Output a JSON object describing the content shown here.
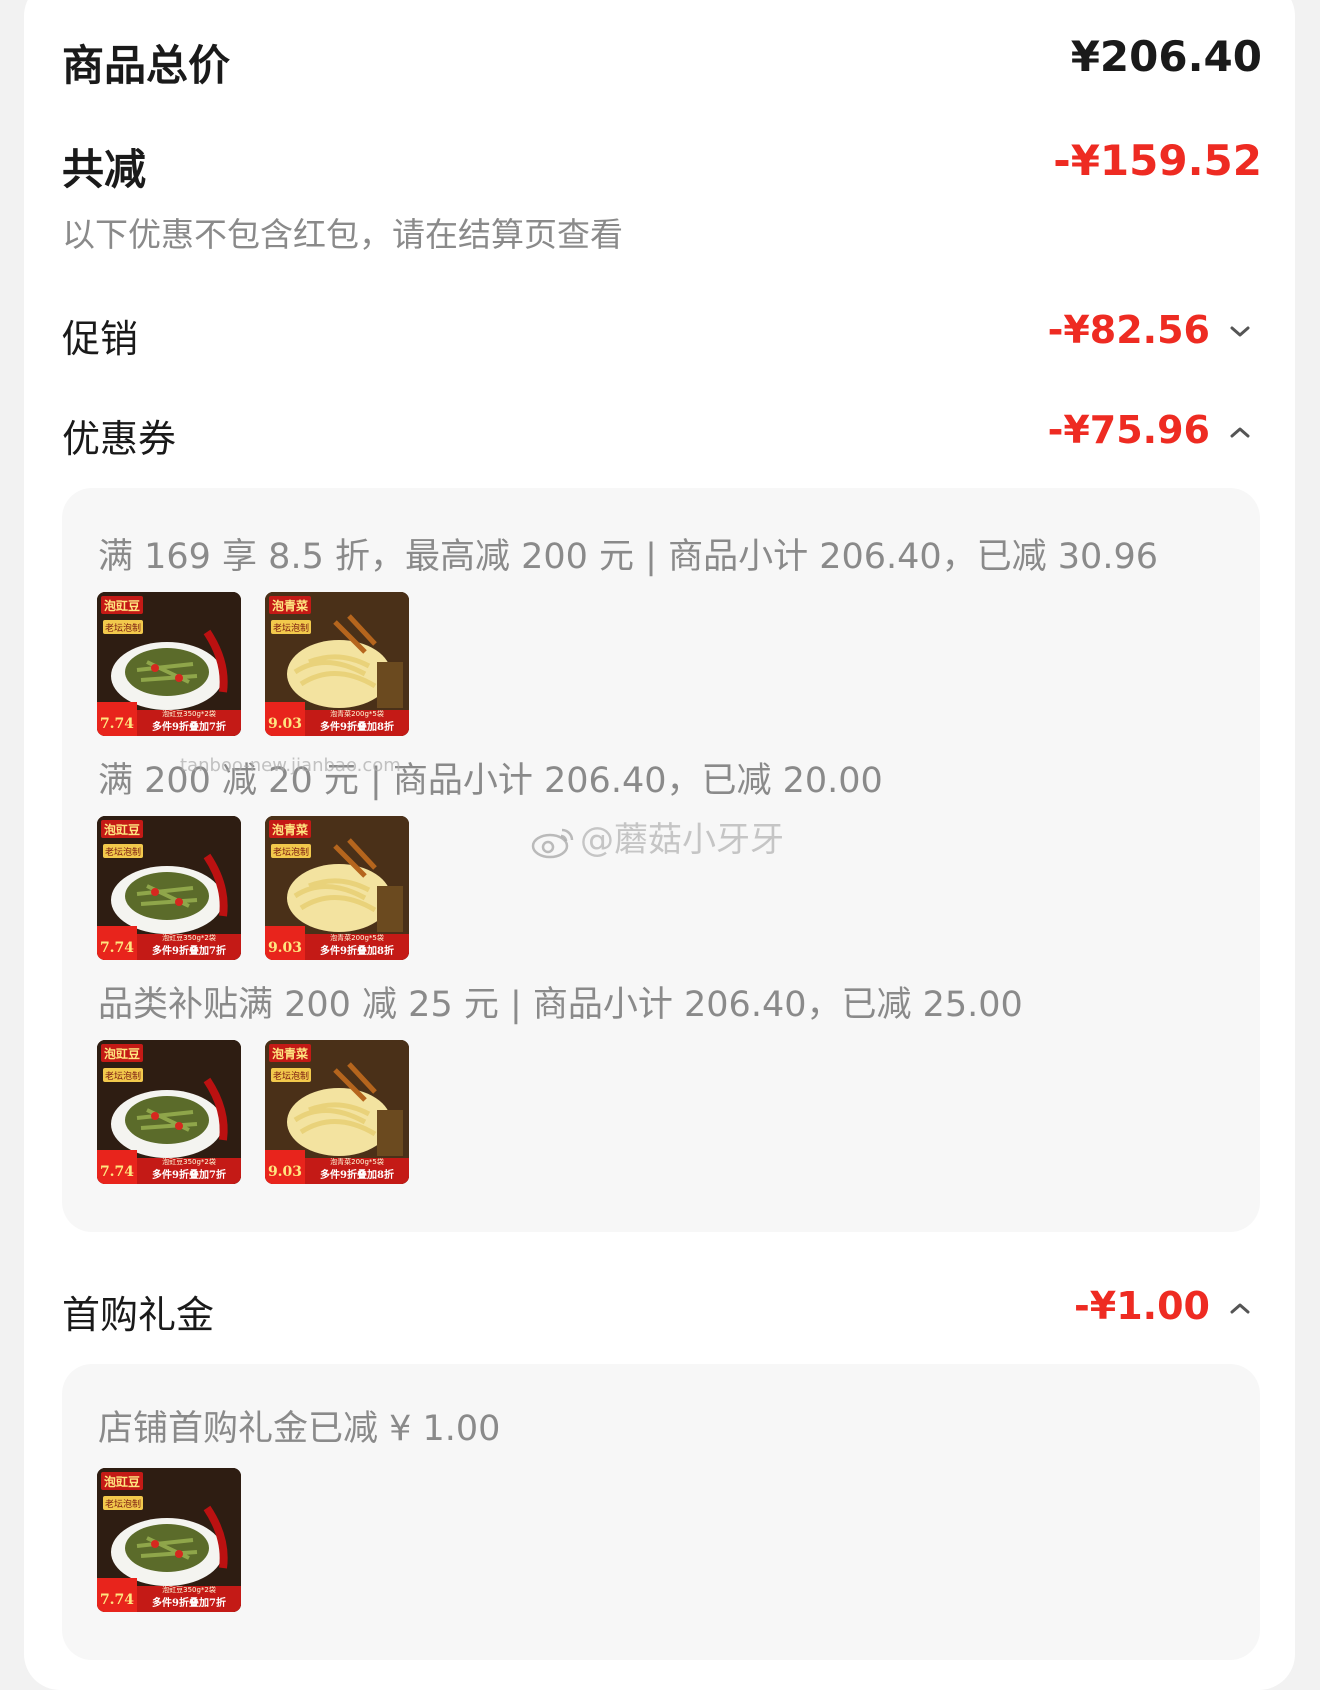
{
  "summary": {
    "total_label": "商品总价",
    "total_value": "¥206.40",
    "discount_label": "共减",
    "discount_value": "-¥159.52",
    "note": "以下优惠不包含红包，请在结算页查看"
  },
  "promotion": {
    "label": "促销",
    "value": "-¥82.56",
    "expanded": false
  },
  "coupon": {
    "label": "优惠券",
    "value": "-¥75.96",
    "expanded": true,
    "entries": [
      {
        "text": "满 169 享 8.5 折，最高减 200 元 | 商品小计 206.40，已减 30.96",
        "products": [
          "泡豇豆",
          "泡青菜"
        ]
      },
      {
        "text": "满 200 减 20 元 | 商品小计 206.40，已减 20.00",
        "products": [
          "泡豇豆",
          "泡青菜"
        ]
      },
      {
        "text": "品类补贴满 200 减 25 元 | 商品小计 206.40，已减 25.00",
        "products": [
          "泡豇豆",
          "泡青菜"
        ]
      }
    ]
  },
  "first_purchase": {
    "label": "首购礼金",
    "value": "-¥1.00",
    "expanded": true,
    "entries": [
      {
        "text": "店铺首购礼金已减 ¥ 1.00",
        "products": [
          "泡豇豆"
        ]
      }
    ]
  },
  "product_cards": {
    "泡豇豆": {
      "name": "泡豇豆",
      "tag": "老坛泡制",
      "price": "7.74",
      "promo": "多件9折叠加7折",
      "spec": "泡豇豆350g*2袋"
    },
    "泡青菜": {
      "name": "泡青菜",
      "tag": "老坛泡制",
      "price": "9.03",
      "promo": "多件9折叠加8折",
      "spec": "泡青菜200g*5袋"
    }
  },
  "watermark": {
    "handle": "@蘑菇小牙牙",
    "url": "tanboo-new.jianbao.com"
  },
  "colors": {
    "accent_red": "#ee2b22",
    "text_dark": "#1a1a1a",
    "text_gray": "#8a8a8a",
    "panel_bg": "#f7f7f7"
  }
}
